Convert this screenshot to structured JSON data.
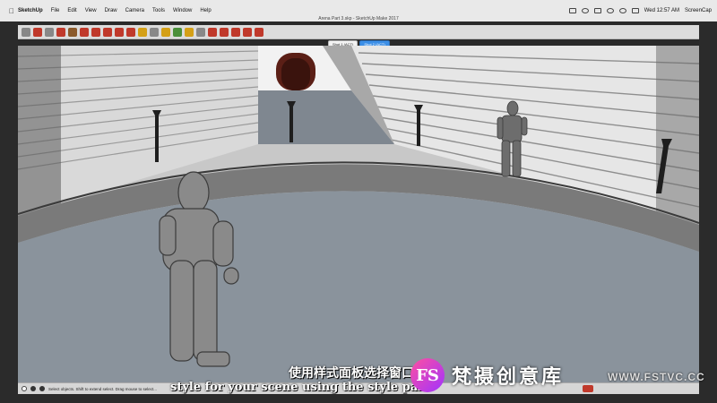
{
  "menubar": {
    "app_name": "SketchUp",
    "menus": [
      "File",
      "Edit",
      "View",
      "Draw",
      "Camera",
      "Tools",
      "Window",
      "Help"
    ],
    "clock": "Wed 12:57 AM",
    "recorder": "ScreenCap"
  },
  "window": {
    "title": "Arena Part 3.skp - SketchUp Make 2017"
  },
  "toolbar": {
    "tools": [
      {
        "icon": "select-arrow-icon",
        "color": "#555555"
      },
      {
        "icon": "eraser-icon",
        "color": "#d46a8a"
      },
      {
        "icon": "pencil-line-icon",
        "color": "#555555"
      },
      {
        "icon": "arc-icon",
        "color": "#c0392b"
      },
      {
        "icon": "rectangle-icon",
        "color": "#8b5a2b"
      },
      {
        "icon": "push-pull-icon",
        "color": "#c0392b"
      },
      {
        "icon": "move-icon",
        "color": "#c0392b"
      },
      {
        "icon": "rotate-icon",
        "color": "#c0392b"
      },
      {
        "icon": "scale-icon",
        "color": "#c0392b"
      },
      {
        "icon": "offset-icon",
        "color": "#c0392b"
      },
      {
        "icon": "tape-measure-icon",
        "color": "#d4a017"
      },
      {
        "icon": "text-icon",
        "color": "#888888"
      },
      {
        "icon": "paint-bucket-icon",
        "color": "#d4a017"
      },
      {
        "icon": "orbit-icon",
        "color": "#4a8f3a"
      },
      {
        "icon": "pan-icon",
        "color": "#d4a017"
      },
      {
        "icon": "zoom-icon",
        "color": "#888888"
      },
      {
        "icon": "zoom-extents-icon",
        "color": "#c0392b"
      },
      {
        "icon": "3d-warehouse-icon",
        "color": "#c0392b"
      },
      {
        "icon": "extension-warehouse-icon",
        "color": "#c0392b"
      },
      {
        "icon": "layout-icon",
        "color": "#c0392b"
      },
      {
        "icon": "extension-manager-icon",
        "color": "#c0392b"
      }
    ]
  },
  "scene_tabs": [
    {
      "label": "Shot 1 (ACT)",
      "active": false
    },
    {
      "label": "Shot 2 (ACT)",
      "active": true
    }
  ],
  "statusbar": {
    "message": "Select objects. Shift to extend select. Drag mouse to select..."
  },
  "subtitles": {
    "chinese": "使用样式面板选择窗口",
    "english": "style for your scene using the style pale"
  },
  "watermark": {
    "logo": "FS",
    "name": "梵摄创意库",
    "url": "WWW.FSTVC.CC"
  },
  "colors": {
    "accent_tab": "#3b8ee6",
    "menubar_bg": "#e9e9e9",
    "floor": "#8a939c",
    "walls": "#d9d9d9"
  }
}
